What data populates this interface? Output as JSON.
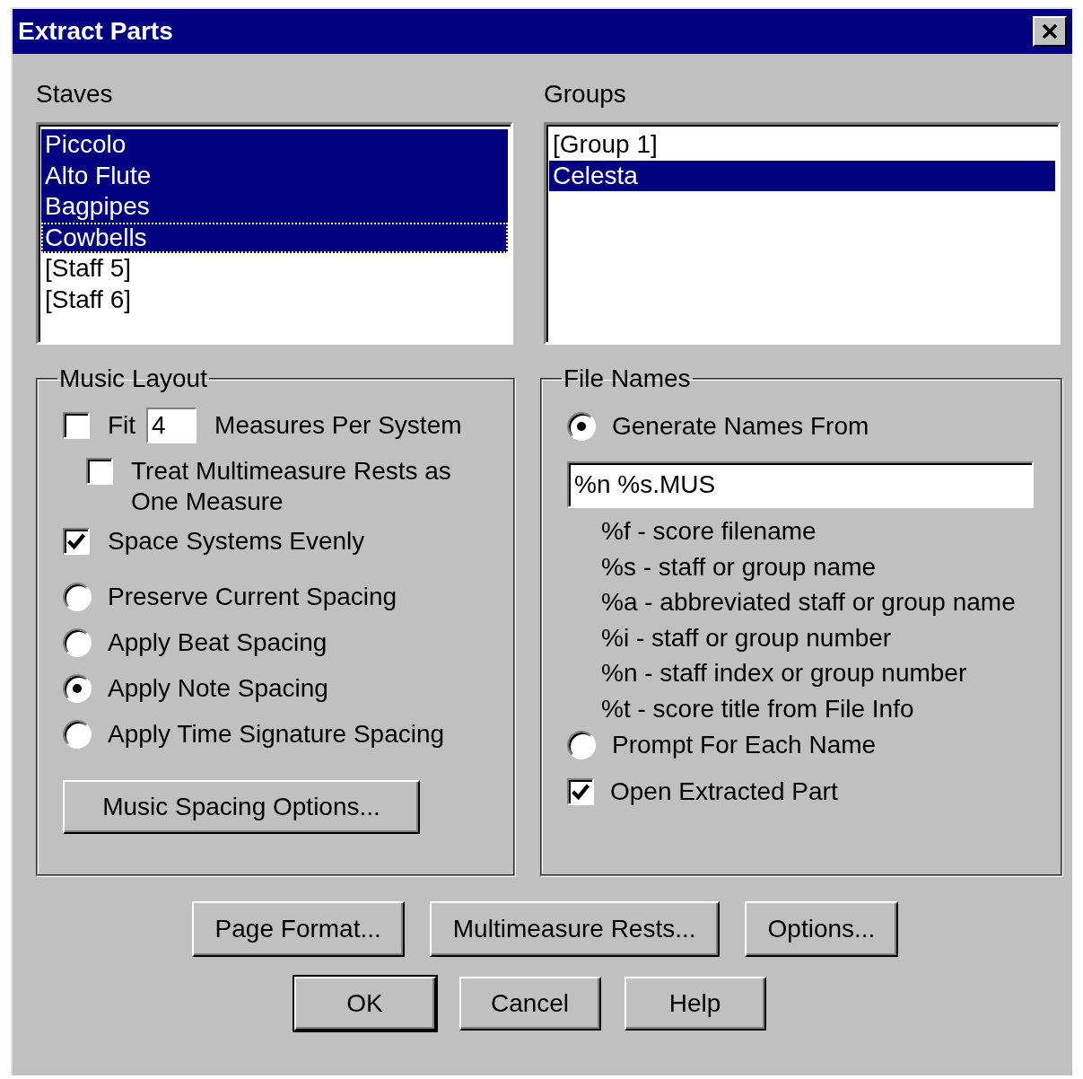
{
  "window": {
    "title": "Extract Parts"
  },
  "staves": {
    "label": "Staves",
    "items": [
      {
        "name": "Piccolo",
        "selected": true,
        "focused": false
      },
      {
        "name": "Alto Flute",
        "selected": true,
        "focused": false
      },
      {
        "name": "Bagpipes",
        "selected": true,
        "focused": false
      },
      {
        "name": "Cowbells",
        "selected": true,
        "focused": true
      },
      {
        "name": "[Staff 5]",
        "selected": false,
        "focused": false
      },
      {
        "name": "[Staff 6]",
        "selected": false,
        "focused": false
      }
    ]
  },
  "groups": {
    "label": "Groups",
    "items": [
      {
        "name": "[Group 1]",
        "selected": false
      },
      {
        "name": "Celesta",
        "selected": true
      }
    ]
  },
  "music_layout": {
    "title": "Music Layout",
    "fit": {
      "label": "Fit",
      "checked": false,
      "value": "4",
      "suffix": "Measures Per System"
    },
    "treat_rests": {
      "label": "Treat Multimeasure Rests as One Measure",
      "checked": false
    },
    "space_evenly": {
      "label": "Space Systems Evenly",
      "checked": true
    },
    "spacing": [
      {
        "label": "Preserve Current Spacing",
        "selected": false
      },
      {
        "label": "Apply Beat Spacing",
        "selected": false
      },
      {
        "label": "Apply Note Spacing",
        "selected": true
      },
      {
        "label": "Apply Time Signature Spacing",
        "selected": false
      }
    ],
    "button": "Music Spacing Options..."
  },
  "file_names": {
    "title": "File Names",
    "generate": {
      "label": "Generate Names From",
      "selected": true
    },
    "pattern": "%n %s.MUS",
    "codes": [
      "%f - score filename",
      "%s - staff or group name",
      "%a - abbreviated staff or group name",
      "%i - staff or group number",
      "%n - staff index or group number",
      "%t - score title from File Info"
    ],
    "prompt": {
      "label": "Prompt For Each Name",
      "selected": false
    },
    "open_part": {
      "label": "Open Extracted Part",
      "checked": true
    }
  },
  "buttons_row1": [
    "Page Format...",
    "Multimeasure Rests...",
    "Options..."
  ],
  "buttons_row2": [
    {
      "label": "OK",
      "default": true
    },
    {
      "label": "Cancel",
      "default": false
    },
    {
      "label": "Help",
      "default": false
    }
  ]
}
